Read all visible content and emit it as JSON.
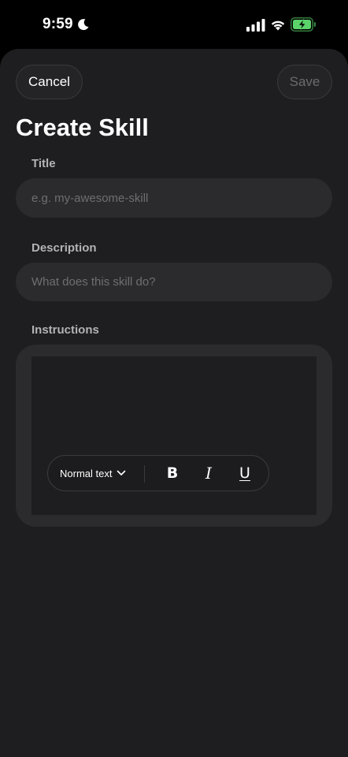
{
  "status_bar": {
    "time": "9:59",
    "icons": [
      "moon-icon",
      "signal-icon",
      "wifi-icon",
      "battery-charging-icon"
    ]
  },
  "header": {
    "cancel_label": "Cancel",
    "save_label": "Save",
    "title": "Create Skill"
  },
  "form": {
    "title": {
      "label": "Title",
      "placeholder": "e.g. my-awesome-skill",
      "value": ""
    },
    "description": {
      "label": "Description",
      "placeholder": "What does this skill do?",
      "value": ""
    },
    "instructions": {
      "label": "Instructions",
      "value": ""
    }
  },
  "toolbar": {
    "text_style": "Normal text",
    "bold": "B",
    "italic": "I",
    "underline": "U"
  },
  "colors": {
    "background": "#1e1e20",
    "field": "#2b2b2e",
    "text": "#ffffff",
    "muted_text": "#b3b3b6",
    "disabled": "#6b6b6f",
    "battery_green": "#5bd26a"
  }
}
